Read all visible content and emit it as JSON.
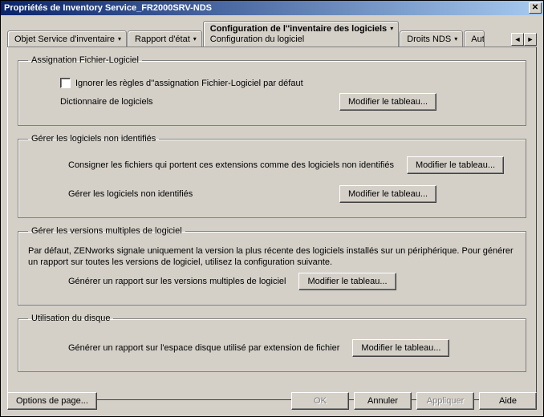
{
  "window": {
    "title": "Propriétés de Inventory Service_FR2000SRV-NDS"
  },
  "tabs": {
    "t0": "Objet Service d'inventaire",
    "t1": "Rapport d'état",
    "t2_main": "Configuration de l''inventaire des logiciels",
    "t2_sub": "Configuration du logiciel",
    "t3": "Droits NDS",
    "t4": "Aut"
  },
  "groups": {
    "assign": {
      "legend": "Assignation Fichier-Logiciel",
      "ignore": "Ignorer les règles d''assignation Fichier-Logiciel par défaut",
      "dict": "Dictionnaire de logiciels"
    },
    "unident": {
      "legend": "Gérer les logiciels non identifiés",
      "log_ext": "Consigner les fichiers qui portent ces extensions comme des logiciels non identifiés",
      "manage": "Gérer les logiciels non identifiés"
    },
    "multiver": {
      "legend": "Gérer les versions multiples de logiciel",
      "desc": "Par défaut, ZENworks signale uniquement la version la plus récente des logiciels installés sur un périphérique. Pour générer un rapport sur toutes les versions de logiciel, utilisez la configuration suivante.",
      "generate": "Générer un rapport sur les versions multiples de logiciel"
    },
    "disk": {
      "legend": "Utilisation du disque",
      "generate": "Générer un rapport sur l'espace disque utilisé par extension de fichier"
    }
  },
  "buttons": {
    "modtable": "Modifier le tableau...",
    "pageopts": "Options de page...",
    "ok": "OK",
    "cancel": "Annuler",
    "apply": "Appliquer",
    "help": "Aide"
  }
}
